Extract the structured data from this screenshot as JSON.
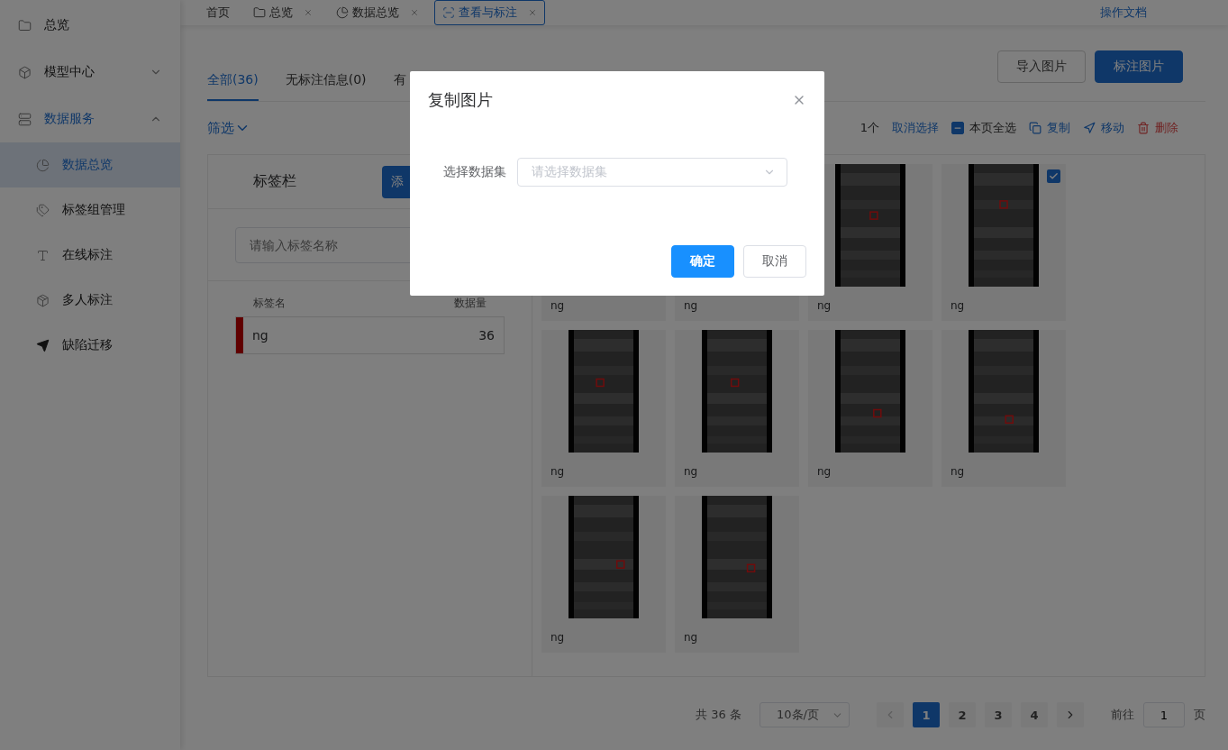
{
  "sidebar": {
    "items": [
      {
        "label": "总览",
        "expandable": false,
        "expanded": false
      },
      {
        "label": "模型中心",
        "expandable": true,
        "expanded": false
      },
      {
        "label": "数据服务",
        "expandable": true,
        "expanded": true,
        "children": [
          {
            "label": "数据总览",
            "selected": true
          },
          {
            "label": "标签组管理",
            "selected": false
          },
          {
            "label": "在线标注",
            "selected": false
          },
          {
            "label": "多人标注",
            "selected": false
          },
          {
            "label": "缺陷迁移",
            "selected": false
          }
        ]
      }
    ]
  },
  "top_tabs": [
    {
      "label": "首页",
      "closable": false,
      "selected": false
    },
    {
      "label": "总览",
      "closable": true,
      "selected": false
    },
    {
      "label": "数据总览",
      "closable": true,
      "selected": false
    },
    {
      "label": "查看与标注",
      "closable": true,
      "selected": true
    }
  ],
  "docs_link": "操作文档",
  "filter_tabs": [
    {
      "label": "全部(36)",
      "selected": true
    },
    {
      "label": "无标注信息(0)",
      "selected": false
    },
    {
      "label": "有",
      "selected": false
    }
  ],
  "actions": {
    "import": "导入图片",
    "annotate": "标注图片"
  },
  "filter": "筛选",
  "toolbar": {
    "selected_count": "1个",
    "cancel": "取消选择",
    "select_page": "本页全选",
    "select_page_indeterminate": true,
    "copy": "复制",
    "move": "移动",
    "delete": "删除"
  },
  "label_panel": {
    "title": "标签栏",
    "add_button": "添",
    "search_placeholder": "请输入标签名称",
    "columns": [
      "标签名",
      "数据量"
    ],
    "rows": [
      {
        "name": "ng",
        "count": "36",
        "color": "#600000"
      }
    ]
  },
  "images": [
    {
      "label": "ng",
      "selected": false
    },
    {
      "label": "ng",
      "selected": false
    },
    {
      "label": "ng",
      "selected": false
    },
    {
      "label": "ng",
      "selected": true
    },
    {
      "label": "ng",
      "selected": false
    },
    {
      "label": "ng",
      "selected": false
    },
    {
      "label": "ng",
      "selected": false
    },
    {
      "label": "ng",
      "selected": false
    },
    {
      "label": "ng",
      "selected": false
    },
    {
      "label": "ng",
      "selected": false
    }
  ],
  "pagination": {
    "total": "共 36 条",
    "page_size": "10条/页",
    "pages": [
      {
        "label": "1",
        "selected": true
      },
      {
        "label": "2",
        "selected": false
      },
      {
        "label": "3",
        "selected": false
      },
      {
        "label": "4",
        "selected": false
      }
    ],
    "goto_label": "前往",
    "goto_value": "1",
    "goto_suffix": "页"
  },
  "dialog": {
    "title": "复制图片",
    "field_label": "选择数据集",
    "field_placeholder": "请选择数据集",
    "confirm": "确定",
    "cancel": "取消"
  }
}
